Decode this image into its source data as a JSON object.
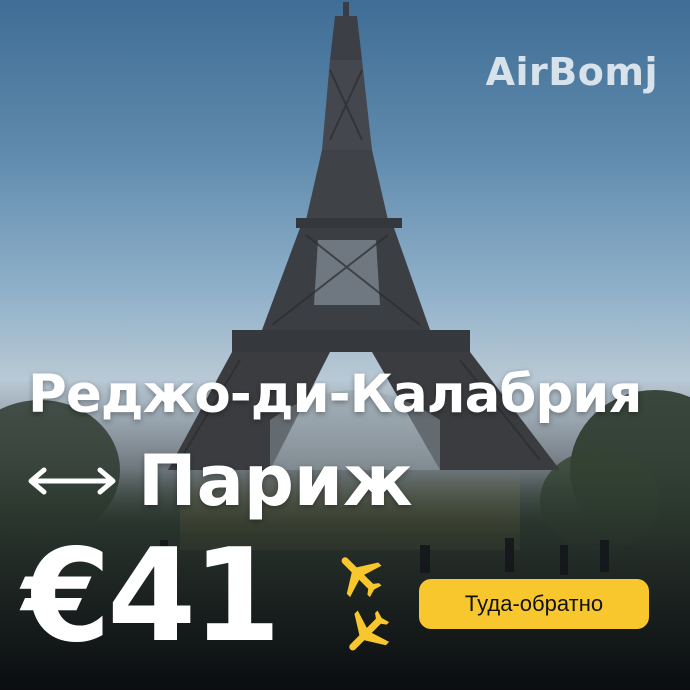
{
  "brand": {
    "name": "AirBomj"
  },
  "route": {
    "origin": "Реджо-ди-Калабрия",
    "destination": "Париж"
  },
  "offer": {
    "price": "€41",
    "trip_type": "Туда-обратно"
  },
  "colors": {
    "accent": "#f8c72d",
    "text": "#ffffff"
  },
  "icons": [
    "round-trip-arrow-icon",
    "airplane-icon",
    "airplane-icon"
  ]
}
